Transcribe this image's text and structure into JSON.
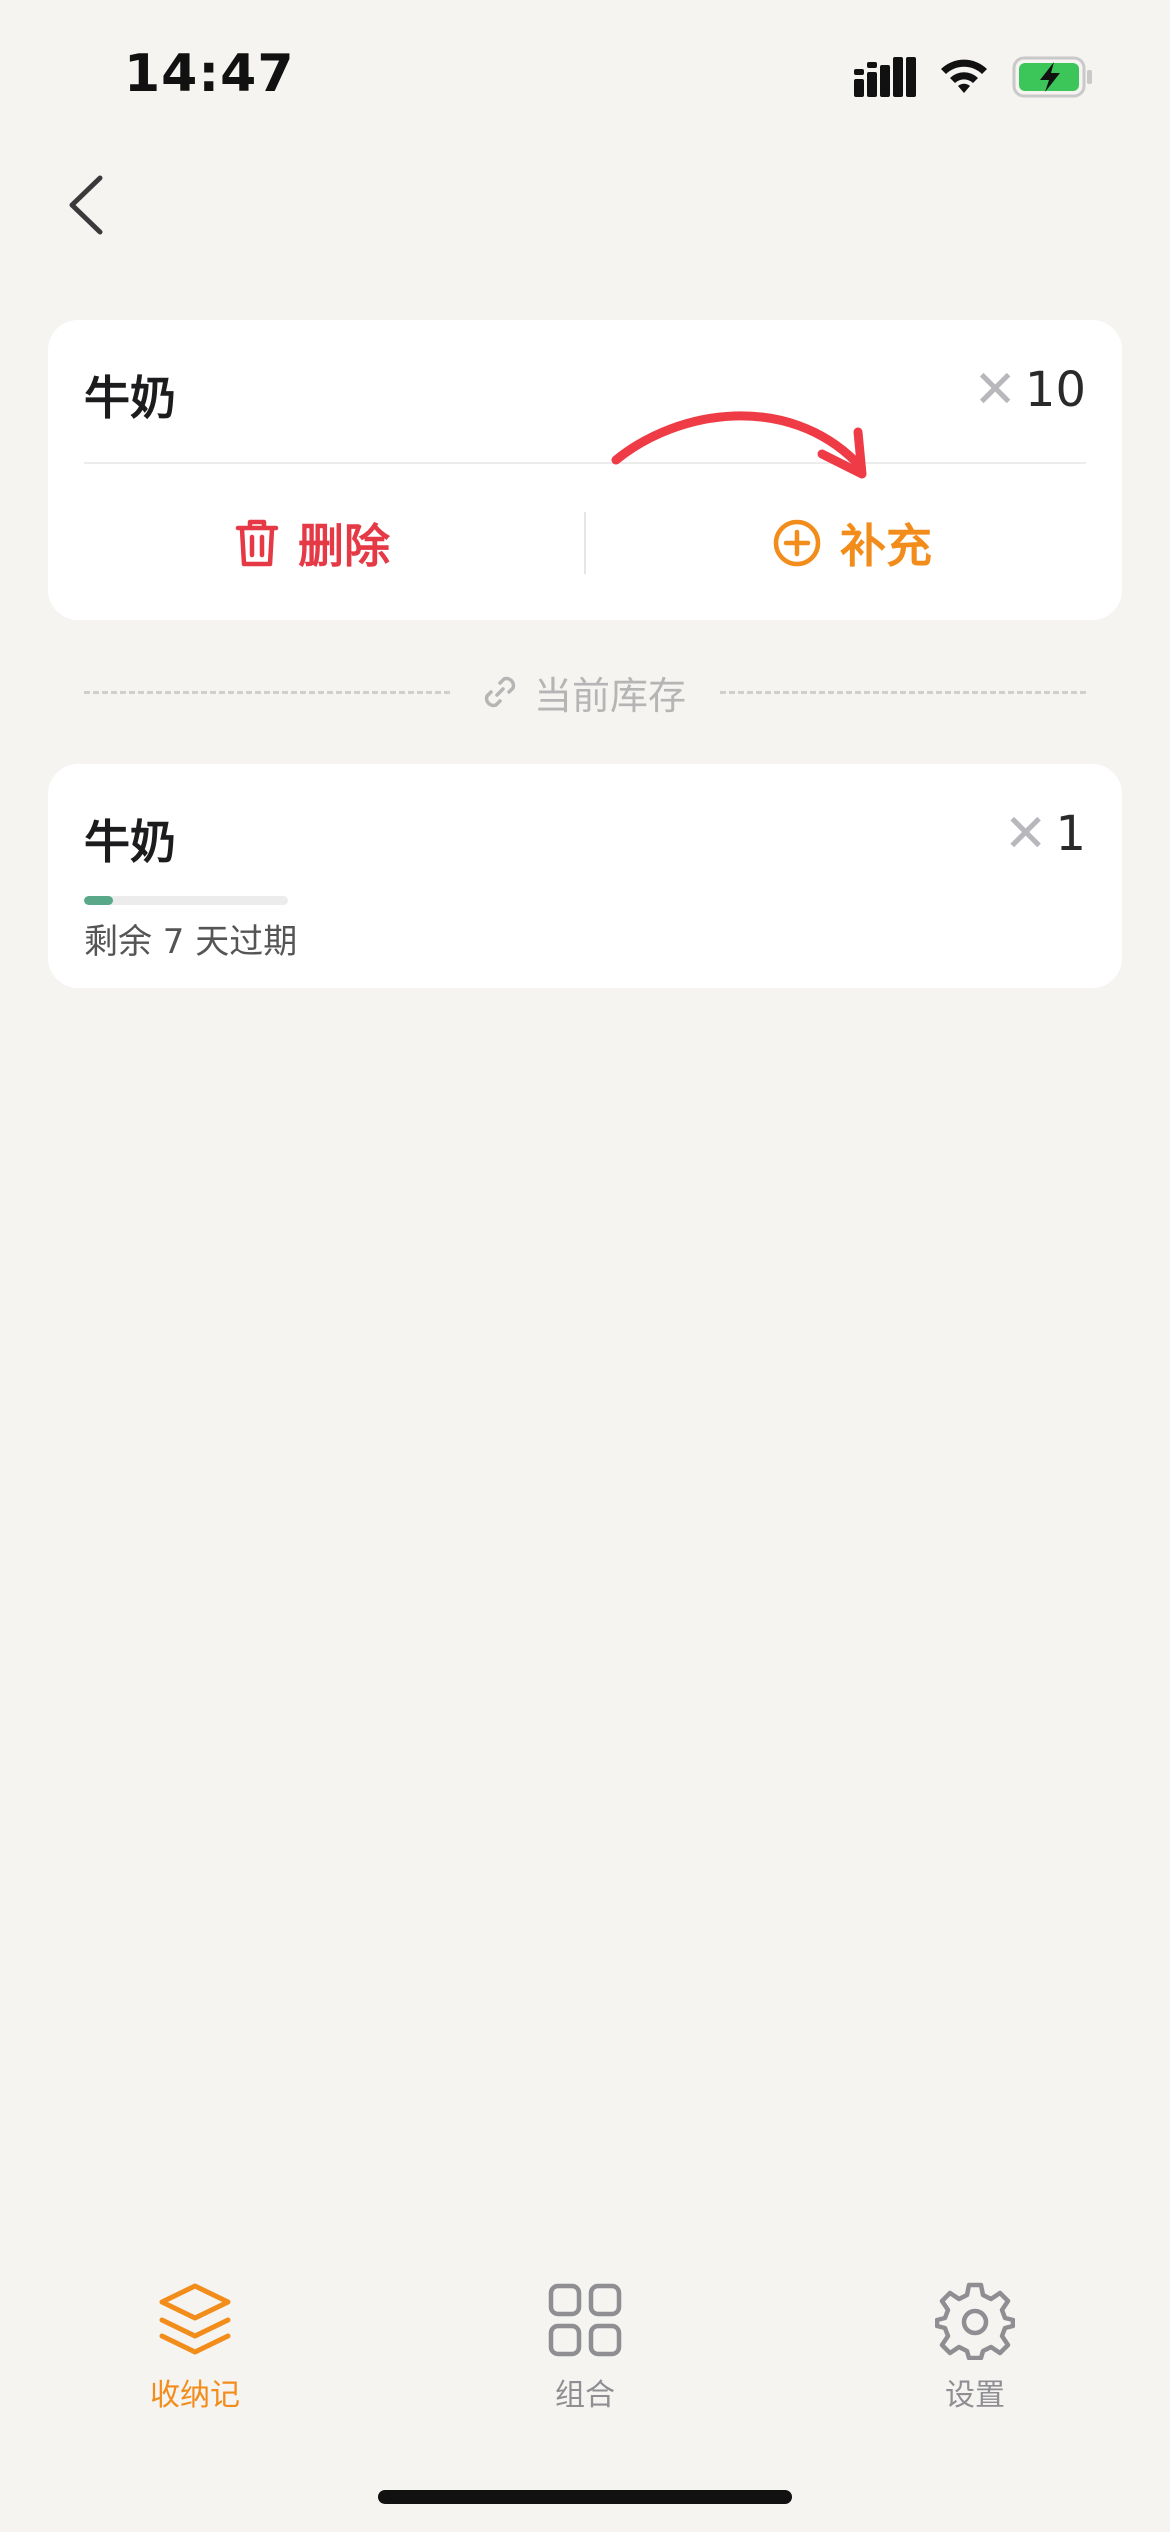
{
  "status_bar": {
    "time": "14:47"
  },
  "top_card": {
    "item_name": "牛奶",
    "quantity": "10",
    "delete_label": "删除",
    "add_label": "补充"
  },
  "section": {
    "label": "当前库存"
  },
  "inventory_card": {
    "item_name": "牛奶",
    "quantity": "1",
    "expiry_text": "剩余 7 天过期",
    "freshness_fraction": 0.14
  },
  "tab_bar": {
    "tabs": [
      {
        "label": "收纳记",
        "icon": "layers-icon",
        "active": true
      },
      {
        "label": "组合",
        "icon": "grid-icon",
        "active": false
      },
      {
        "label": "设置",
        "icon": "gear-icon",
        "active": false
      }
    ]
  },
  "colors": {
    "accent": "#f28c1b",
    "danger": "#e63946",
    "arrow": "#ef3b45",
    "progress": "#5aa88a",
    "background": "#f5f4f1"
  }
}
